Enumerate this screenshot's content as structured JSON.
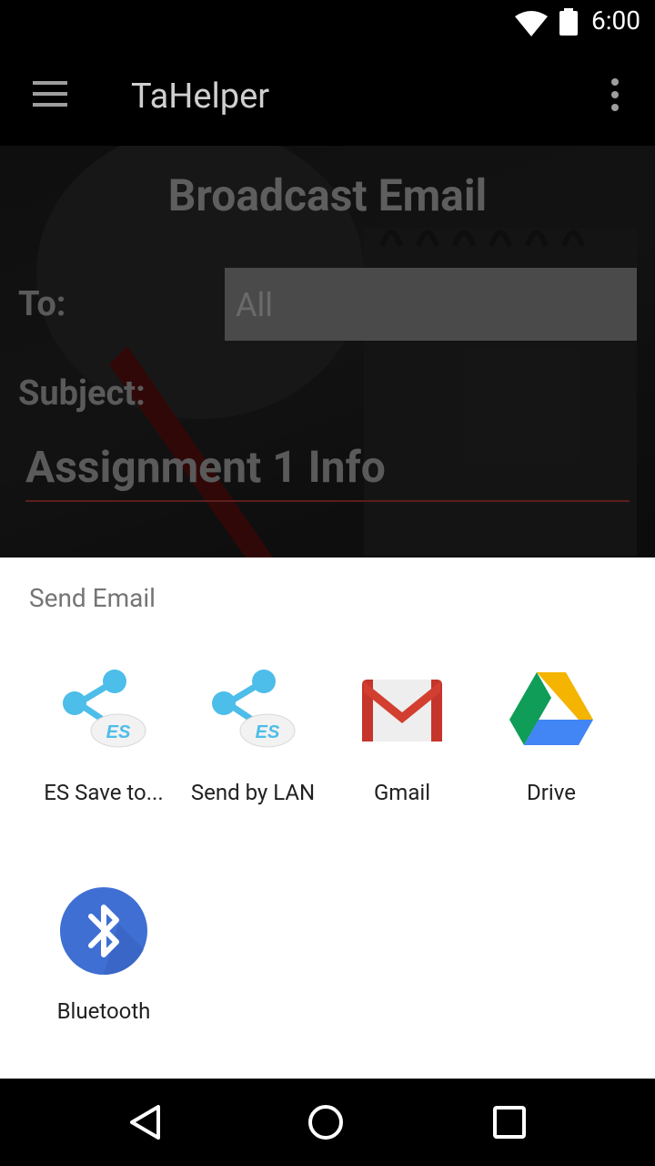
{
  "status_bar": {
    "time": "6:00"
  },
  "app_bar": {
    "title": "TaHelper"
  },
  "form": {
    "page_title": "Broadcast Email",
    "to_label": "To:",
    "to_value": "All",
    "subject_label": "Subject:",
    "subject_value": "Assignment 1 Info"
  },
  "share_sheet": {
    "title": "Send Email",
    "apps": [
      {
        "label": "ES Save to...",
        "icon": "es-share-icon"
      },
      {
        "label": "Send by LAN",
        "icon": "es-share-icon"
      },
      {
        "label": "Gmail",
        "icon": "gmail-icon"
      },
      {
        "label": "Drive",
        "icon": "drive-icon"
      },
      {
        "label": "Bluetooth",
        "icon": "bluetooth-icon"
      }
    ]
  },
  "colors": {
    "es_blue": "#4dbde9",
    "gmail_red": "#d23f31",
    "drive_green": "#0f9d58",
    "drive_yellow": "#f4b400",
    "drive_blue": "#4285f4",
    "bluetooth_blue": "#3f6fd2"
  }
}
